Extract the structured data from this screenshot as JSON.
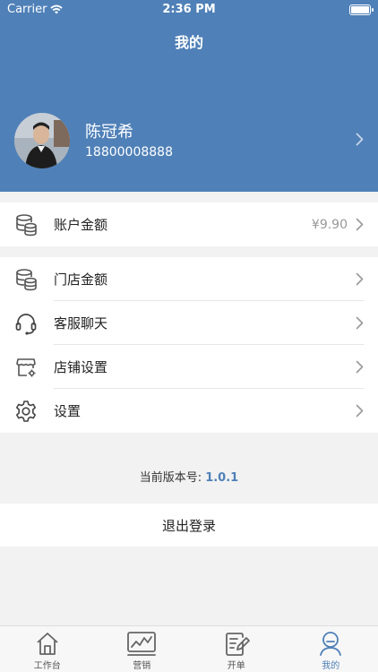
{
  "status_bar": {
    "carrier": "Carrier",
    "time": "2:36 PM"
  },
  "nav": {
    "title": "我的"
  },
  "profile": {
    "name": "陈冠希",
    "phone": "18800008888"
  },
  "account": {
    "label": "账户金额",
    "value": "¥9.90"
  },
  "menu": [
    {
      "label": "门店金额",
      "icon": "database-icon"
    },
    {
      "label": "客服聊天",
      "icon": "headset-icon"
    },
    {
      "label": "店铺设置",
      "icon": "store-settings-icon"
    },
    {
      "label": "设置",
      "icon": "gear-icon"
    }
  ],
  "version": {
    "label": "当前版本号:",
    "number": "1.0.1"
  },
  "logout_label": "退出登录",
  "tabs": [
    {
      "label": "工作台",
      "icon": "home-icon",
      "active": false
    },
    {
      "label": "营销",
      "icon": "chart-icon",
      "active": false
    },
    {
      "label": "开单",
      "icon": "edit-note-icon",
      "active": false
    },
    {
      "label": "我的",
      "icon": "user-icon",
      "active": true
    }
  ],
  "colors": {
    "brand": "#4f80b8",
    "background": "#f2f2f2"
  }
}
